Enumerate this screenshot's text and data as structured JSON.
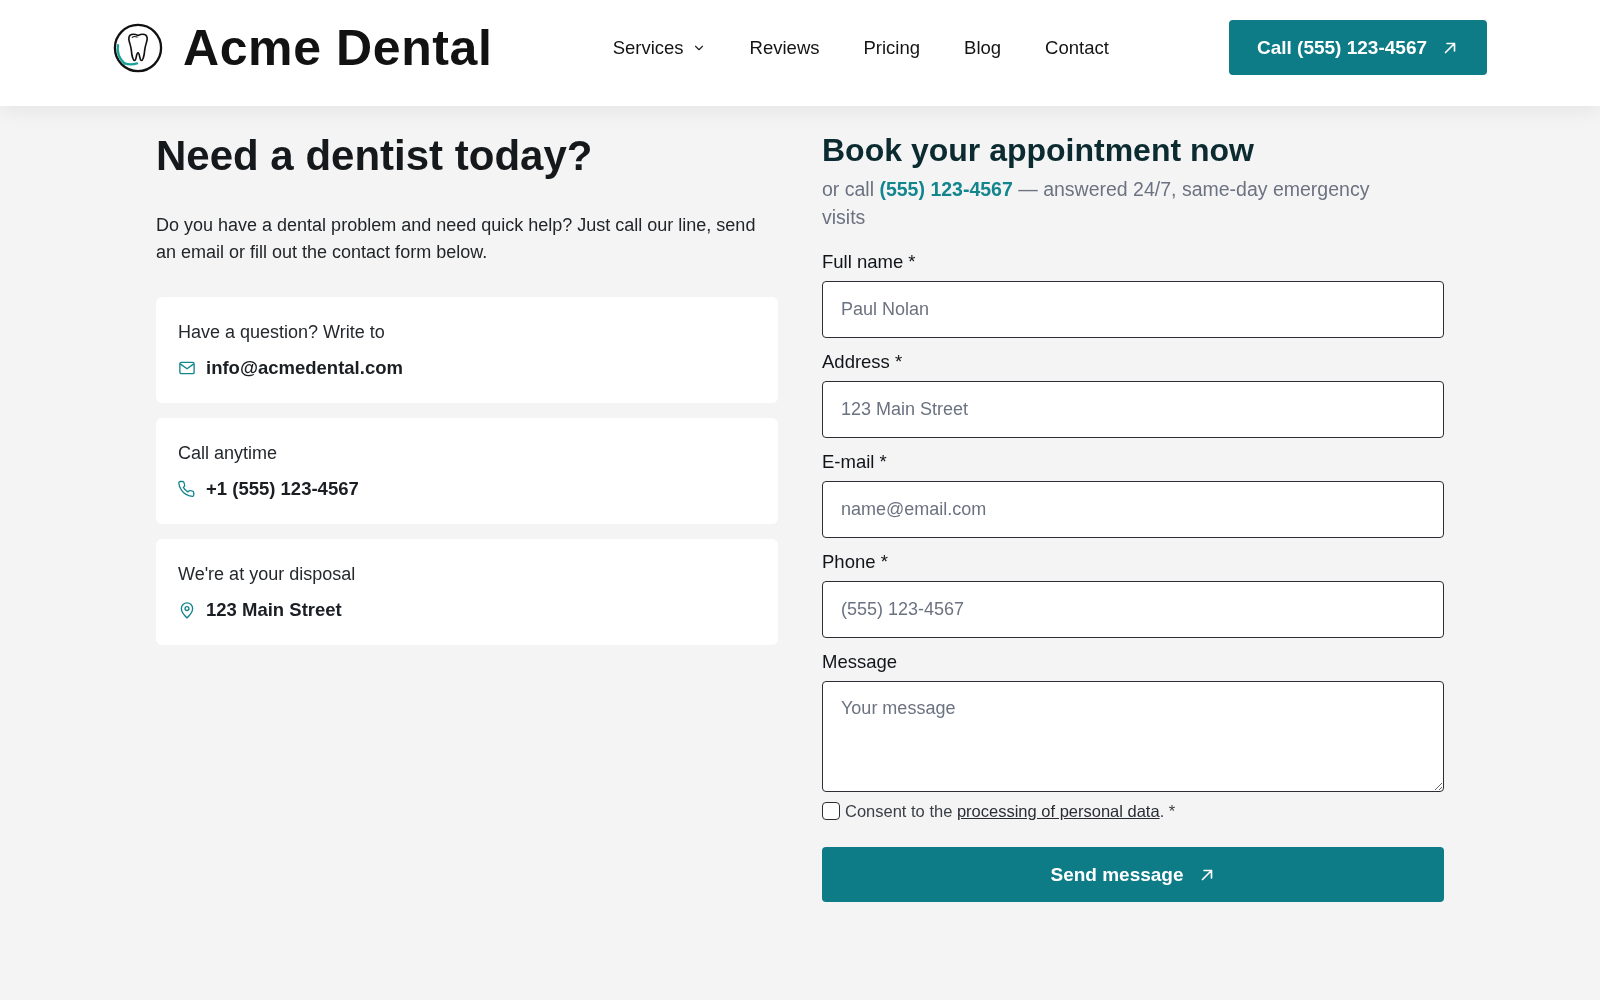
{
  "header": {
    "logo": {
      "text": "Acme Dental"
    },
    "nav": [
      {
        "label": "Services",
        "dropdown": true
      },
      {
        "label": "Reviews",
        "dropdown": false
      },
      {
        "label": "Pricing",
        "dropdown": false
      },
      {
        "label": "Blog",
        "dropdown": false
      },
      {
        "label": "Contact",
        "dropdown": false
      }
    ],
    "call_button": {
      "label": "Call (555) 123-4567"
    }
  },
  "intro": {
    "title": "Need a dentist today?",
    "text": "Do you have a dental problem and need quick help? Just call our line, send an email or fill out the contact form below."
  },
  "contact_cards": [
    {
      "kind": "email",
      "caption": "Have a question? Write to",
      "value": "info@acmedental.com"
    },
    {
      "kind": "phone",
      "caption": "Call anytime",
      "value": "+1 (555) 123-4567"
    },
    {
      "kind": "address",
      "caption": "We're at your disposal",
      "value": "123 Main Street"
    }
  ],
  "form": {
    "title": "Book your appointment now",
    "subtitle": {
      "lead": "or call",
      "phone": "(555) 123-4567",
      "rest": "— answered 24/7, same-day emergency visits"
    },
    "fields": [
      {
        "kind": "input",
        "label": "Full name *",
        "placeholder": "Paul Nolan"
      },
      {
        "kind": "input",
        "label": "Address *",
        "placeholder": "123 Main Street"
      },
      {
        "kind": "input",
        "label": "E-mail *",
        "placeholder": "name@email.com"
      },
      {
        "kind": "input",
        "label": "Phone *",
        "placeholder": "(555) 123-4567"
      },
      {
        "kind": "textarea",
        "label": "Message",
        "placeholder": "Your message"
      }
    ],
    "consent": {
      "checked": false,
      "lead": "Consent to the",
      "link": "processing of personal data",
      "rest": ". *"
    },
    "submit": {
      "label": "Send message"
    }
  }
}
